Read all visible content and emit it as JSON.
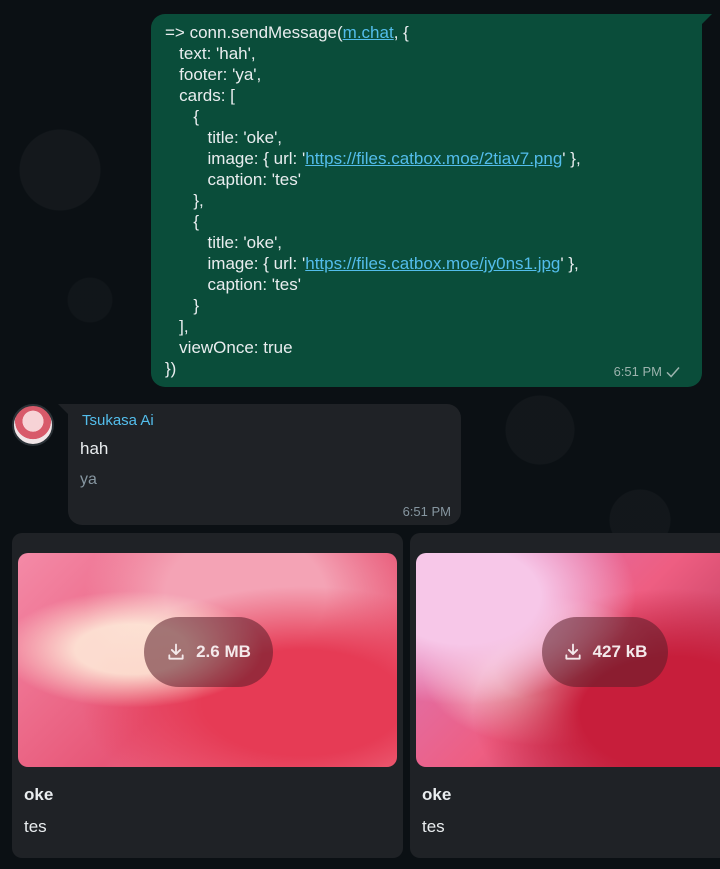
{
  "outgoing": {
    "code_lines": [
      {
        "pre": "=> conn.sendMessage(",
        "link": "m.chat",
        "post": ", {"
      },
      {
        "pre": "   text: 'hah',",
        "link": "",
        "post": ""
      },
      {
        "pre": "   footer: 'ya',",
        "link": "",
        "post": ""
      },
      {
        "pre": "   cards: [",
        "link": "",
        "post": ""
      },
      {
        "pre": "      {",
        "link": "",
        "post": ""
      },
      {
        "pre": "         title: 'oke',",
        "link": "",
        "post": ""
      },
      {
        "pre": "         image: { url: '",
        "link": "https://files.catbox.moe/2tiav7.png",
        "post": "' },"
      },
      {
        "pre": "         caption: 'tes'",
        "link": "",
        "post": ""
      },
      {
        "pre": "      },",
        "link": "",
        "post": ""
      },
      {
        "pre": "      {",
        "link": "",
        "post": ""
      },
      {
        "pre": "         title: 'oke',",
        "link": "",
        "post": ""
      },
      {
        "pre": "         image: { url: '",
        "link": "https://files.catbox.moe/jy0ns1.jpg",
        "post": "' },"
      },
      {
        "pre": "         caption: 'tes'",
        "link": "",
        "post": ""
      },
      {
        "pre": "      }",
        "link": "",
        "post": ""
      },
      {
        "pre": "   ],",
        "link": "",
        "post": ""
      },
      {
        "pre": "   viewOnce: true",
        "link": "",
        "post": ""
      },
      {
        "pre": "})",
        "link": "",
        "post": ""
      }
    ],
    "time": "6:51 PM"
  },
  "incoming": {
    "sender": "Tsukasa Ai",
    "text": "hah",
    "footer": "ya",
    "time": "6:51 PM"
  },
  "cards": [
    {
      "size": "2.6 MB",
      "title": "oke",
      "caption": "tes"
    },
    {
      "size": "427 kB",
      "title": "oke",
      "caption": "tes"
    }
  ],
  "colors": {
    "outgoing_bubble": "#0a4d3a",
    "incoming_bubble": "#1f2226",
    "sender_name": "#53bdeb",
    "link": "#53bdeb"
  },
  "icons": [
    "check-icon",
    "download-icon",
    "avatar"
  ]
}
